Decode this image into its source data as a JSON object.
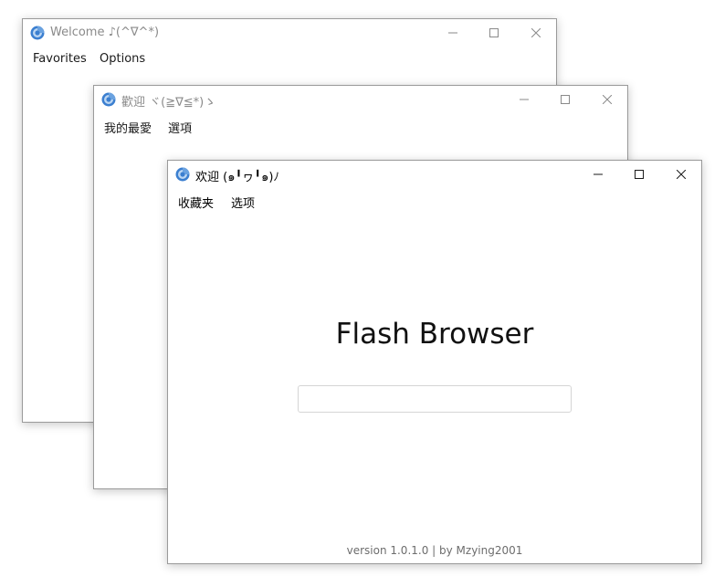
{
  "colors": {
    "icon_blue": "#3b7fd0",
    "icon_light": "#bcd6f2",
    "inactive_glyph": "#8a8a8a",
    "active_glyph": "#1a1a1a"
  },
  "windows": [
    {
      "id": "english",
      "title": "Welcome ♪(^∇^*)",
      "menu": [
        "Favorites",
        "Options"
      ]
    },
    {
      "id": "traditional-chinese",
      "title": "歡迎 ヾ(≧∇≦*)ゝ",
      "menu": [
        "我的最愛",
        "選項"
      ]
    },
    {
      "id": "simplified-chinese",
      "title": "欢迎 (๑╹ヮ╹๑)ﾉ",
      "menu": [
        "收藏夹",
        "选项"
      ],
      "brand": "Flash Browser",
      "search": {
        "value": "",
        "placeholder": ""
      },
      "version": "version 1.0.1.0 | by Mzying2001"
    }
  ],
  "controls": {
    "minimize": "minimize-icon",
    "maximize": "maximize-icon",
    "close": "close-icon"
  }
}
